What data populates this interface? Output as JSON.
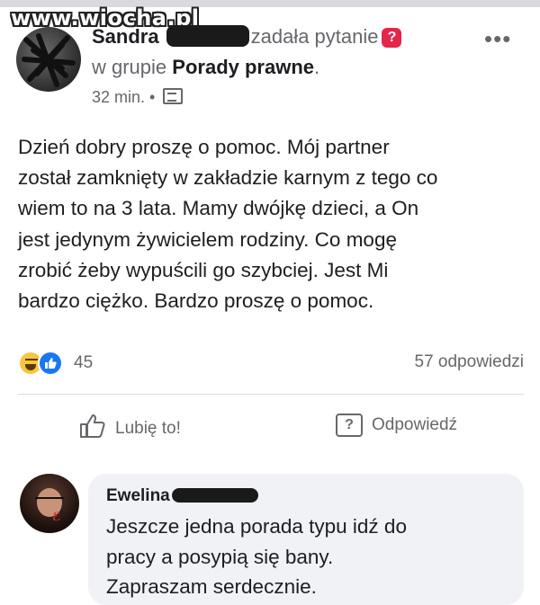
{
  "watermark": "www.wiocha.pl",
  "post": {
    "author": "Sandra",
    "action": "zadała pytanie",
    "question_badge": "?",
    "more_label": "•••",
    "group_prefix": "w grupie",
    "group_name": "Porady prawne",
    "group_suffix": ".",
    "time": "32 min.",
    "time_sep": " • ",
    "body_lines": [
      "Dzień dobry proszę o pomoc. Mój partner",
      "został zamknięty w zakładzie karnym z tego co",
      "wiem to na 3 lata. Mamy dwójkę dzieci, a On",
      "jest jedynym żywicielem rodziny. Co mogę",
      "zrobić żeby wypuścili go szybciej. Jest Mi",
      "bardzo ciężko. Bardzo proszę o pomoc."
    ],
    "reaction_count": "45",
    "replies_count": "57 odpowiedzi",
    "like_label": "Lubię to!",
    "reply_label": "Odpowiedź",
    "reply_icon_glyph": "?"
  },
  "reactions": [
    "haha-icon",
    "like-icon"
  ],
  "comment": {
    "author": "Ewelina",
    "lines": [
      "Jeszcze jedna porada typu idź do",
      "pracy a posypią się bany.",
      "Zapraszam serdecznie."
    ]
  }
}
